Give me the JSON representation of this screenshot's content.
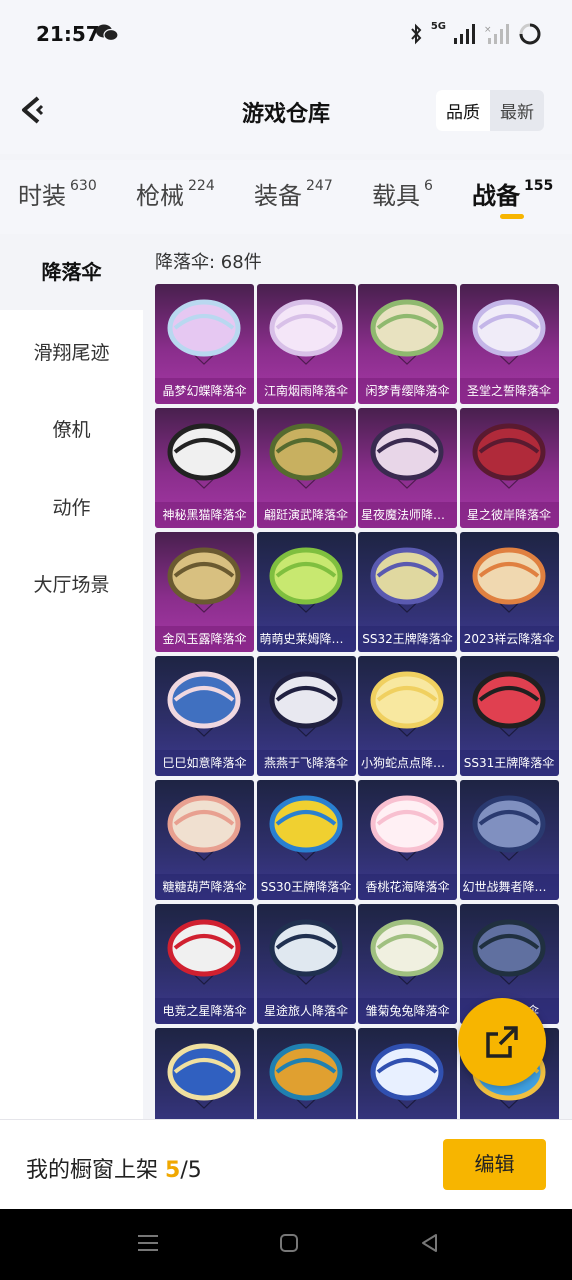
{
  "status_bar": {
    "time": "21:57",
    "network": "5G"
  },
  "header": {
    "title": "游戏仓库",
    "sort_options": [
      "品质",
      "最新"
    ]
  },
  "tabs": [
    {
      "label": "时装",
      "count": "630"
    },
    {
      "label": "枪械",
      "count": "224"
    },
    {
      "label": "装备",
      "count": "247"
    },
    {
      "label": "载具",
      "count": "6"
    },
    {
      "label": "战备",
      "count": "155"
    }
  ],
  "sidebar": {
    "items": [
      "降落伞",
      "滑翔尾迹",
      "僚机",
      "动作",
      "大厅场景"
    ]
  },
  "content": {
    "count_label": "降落伞: 68件",
    "items": [
      {
        "name": "晶梦幻蝶降落伞",
        "rarity": "purple"
      },
      {
        "name": "江南烟雨降落伞",
        "rarity": "purple"
      },
      {
        "name": "闲梦青缨降落伞",
        "rarity": "purple"
      },
      {
        "name": "圣堂之誓降落伞",
        "rarity": "purple"
      },
      {
        "name": "神秘黑猫降落伞",
        "rarity": "purple"
      },
      {
        "name": "翩跹演武降落伞",
        "rarity": "purple"
      },
      {
        "name": "星夜魔法师降落伞",
        "rarity": "purple"
      },
      {
        "name": "星之彼岸降落伞",
        "rarity": "purple"
      },
      {
        "name": "金风玉露降落伞",
        "rarity": "purple"
      },
      {
        "name": "萌萌史莱姆降落伞",
        "rarity": "blue"
      },
      {
        "name": "SS32王牌降落伞",
        "rarity": "blue"
      },
      {
        "name": "2023祥云降落伞",
        "rarity": "blue"
      },
      {
        "name": "巳巳如意降落伞",
        "rarity": "blue"
      },
      {
        "name": "燕燕于飞降落伞",
        "rarity": "blue"
      },
      {
        "name": "小狗蛇点点降落伞",
        "rarity": "blue"
      },
      {
        "name": "SS31王牌降落伞",
        "rarity": "blue"
      },
      {
        "name": "糖糖葫芦降落伞",
        "rarity": "blue"
      },
      {
        "name": "SS30王牌降落伞",
        "rarity": "blue"
      },
      {
        "name": "香桃花海降落伞",
        "rarity": "blue"
      },
      {
        "name": "幻世战舞者降落伞",
        "rarity": "blue"
      },
      {
        "name": "电竞之星降落伞",
        "rarity": "blue"
      },
      {
        "name": "星途旅人降落伞",
        "rarity": "blue"
      },
      {
        "name": "雏菊兔兔降落伞",
        "rarity": "blue"
      },
      {
        "name": "都市降落伞",
        "rarity": "blue"
      },
      {
        "name": "",
        "rarity": "blue"
      },
      {
        "name": "",
        "rarity": "blue"
      },
      {
        "name": "",
        "rarity": "blue"
      },
      {
        "name": "",
        "rarity": "blue"
      }
    ]
  },
  "bottom_bar": {
    "showcase_label": "我的橱窗上架",
    "showcase_current": "5",
    "showcase_sep": "/",
    "showcase_total": "5",
    "edit_label": "编辑"
  },
  "colors": {
    "accent": "#f7b500",
    "purple_card": "#8a2e8c",
    "blue_card": "#2e2f6a"
  },
  "icons": [
    "back-icon",
    "share-icon",
    "wechat-icon",
    "bluetooth-icon",
    "signal-icon",
    "battery-icon",
    "nav-menu-icon",
    "nav-home-icon",
    "nav-back-icon"
  ]
}
